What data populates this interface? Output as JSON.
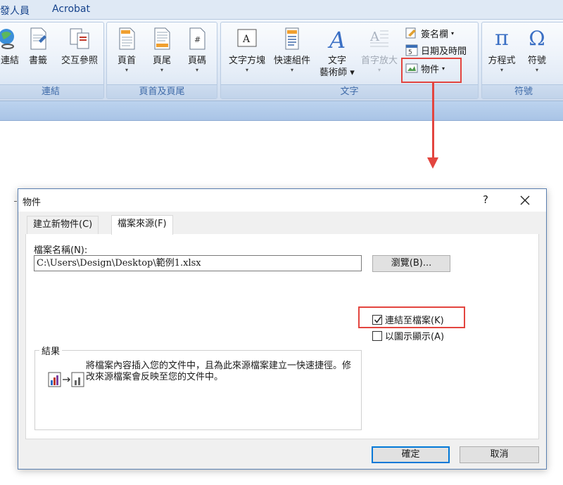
{
  "ribbon": {
    "tabs": [
      {
        "label": "發人員"
      },
      {
        "label": "Acrobat"
      }
    ],
    "groups": {
      "links": {
        "label": "連結",
        "buttons": [
          {
            "label": "連結",
            "icon": "hyperlink-icon"
          },
          {
            "label": "書籤",
            "icon": "bookmark-icon"
          },
          {
            "label": "交互參照",
            "icon": "cross-reference-icon"
          }
        ]
      },
      "header_footer": {
        "label": "頁首及頁尾",
        "buttons": [
          {
            "label": "頁首",
            "icon": "header-icon"
          },
          {
            "label": "頁尾",
            "icon": "footer-icon"
          },
          {
            "label": "頁碼",
            "icon": "page-number-icon"
          }
        ]
      },
      "text": {
        "label": "文字",
        "buttons": [
          {
            "label": "文字方塊",
            "icon": "textbox-icon"
          },
          {
            "label": "快速組件",
            "icon": "quick-parts-icon"
          },
          {
            "label": "文字\n藝術師",
            "line1": "文字",
            "line2": "藝術師",
            "icon": "wordart-icon"
          },
          {
            "label": "首字放大",
            "icon": "drop-cap-icon",
            "disabled": true
          }
        ],
        "small": [
          {
            "label": "簽名欄",
            "icon": "signature-line-icon"
          },
          {
            "label": "日期及時間",
            "icon": "date-time-icon"
          },
          {
            "label": "物件",
            "icon": "object-icon"
          }
        ]
      },
      "symbols": {
        "label": "符號",
        "buttons": [
          {
            "label": "方程式",
            "glyph": "π",
            "icon": "equation-icon"
          },
          {
            "label": "符號",
            "glyph": "Ω",
            "icon": "symbol-icon"
          }
        ]
      }
    }
  },
  "dialog": {
    "title": "物件",
    "help": "?",
    "tabs": [
      {
        "label": "建立新物件(C)",
        "active": false
      },
      {
        "label": "檔案來源(F)",
        "active": true
      }
    ],
    "filename_label": "檔案名稱(N):",
    "filename_value": "C:\\Users\\Design\\Desktop\\範例1.xlsx",
    "browse_label": "瀏覽(B)...",
    "link_to_file": {
      "label": "連結至檔案(K)",
      "checked": true
    },
    "display_as_icon": {
      "label": "以圖示顯示(A)",
      "checked": false
    },
    "result_label": "結果",
    "result_text": "將檔案內容插入您的文件中，且為此來源檔案建立一快速捷徑。修改來源檔案會反映至您的文件中。",
    "ok_label": "確定",
    "cancel_label": "取消"
  },
  "colors": {
    "highlight": "#e3453f",
    "ribbon_label": "#3e6aa8",
    "accent": "#0078d7"
  }
}
